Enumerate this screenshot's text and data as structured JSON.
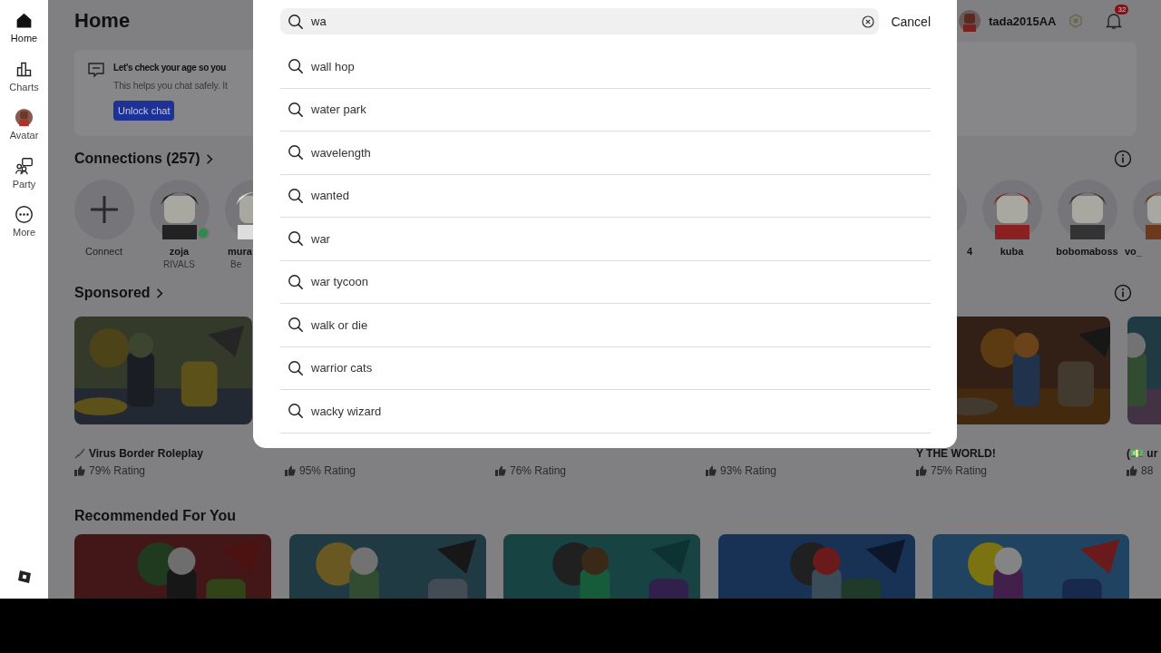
{
  "sidebar": {
    "items": [
      {
        "kind": "home",
        "label": "Home",
        "selected": true
      },
      {
        "kind": "charts",
        "label": "Charts",
        "selected": false
      },
      {
        "kind": "avatar",
        "label": "Avatar",
        "selected": false
      },
      {
        "kind": "party",
        "label": "Party",
        "selected": false
      },
      {
        "kind": "more",
        "label": "More",
        "selected": false
      }
    ]
  },
  "header": {
    "title": "Home",
    "username": "tada2015AA",
    "notification_count": "32"
  },
  "age_banner": {
    "title": "Let's check your age so you",
    "text": "This helps you chat safely. It",
    "button": "Unlock chat"
  },
  "connections": {
    "title": "Connections (257)",
    "left": [
      {
        "kind": "add",
        "name": "Connect"
      },
      {
        "kind": "friend",
        "name": "zoja",
        "status": "RIVALS",
        "online": true
      },
      {
        "kind": "friend",
        "name": "mura",
        "status": "Be"
      }
    ],
    "right": [
      {
        "kind": "friend",
        "name": "4"
      },
      {
        "kind": "friend",
        "name": "kuba"
      },
      {
        "kind": "friend",
        "name": "bobomaboss"
      },
      {
        "kind": "friend",
        "name": "vo_"
      }
    ]
  },
  "sponsored": {
    "title": "Sponsored",
    "games": [
      {
        "kind": "sponsored",
        "title": "Virus Border Roleplay",
        "rating": "79% Rating"
      },
      {
        "kind": "game",
        "rating": "95% Rating"
      },
      {
        "kind": "game",
        "rating": "76% Rating"
      },
      {
        "kind": "game",
        "rating": "93% Rating"
      },
      {
        "kind": "game",
        "title": "Y THE WORLD!",
        "rating": "75% Rating"
      },
      {
        "kind": "game",
        "title": "(💵 ur",
        "rating": "88"
      }
    ]
  },
  "recommended": {
    "title": "Recommended For You"
  },
  "search": {
    "query": "wa",
    "cancel": "Cancel",
    "suggestions": [
      "wall hop",
      "water park",
      "wavelength",
      "wanted",
      "war",
      "war tycoon",
      "walk or die",
      "warrior cats",
      "wacky wizard"
    ]
  }
}
